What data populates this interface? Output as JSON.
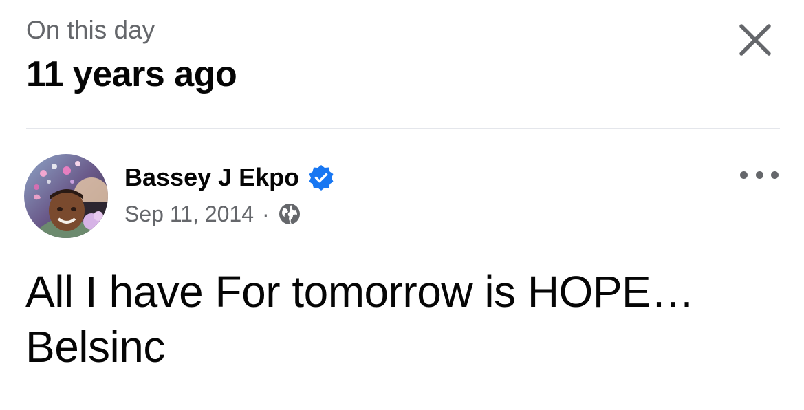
{
  "header": {
    "subtitle": "On this day",
    "title": "11 years ago"
  },
  "post": {
    "author": "Bassey J Ekpo",
    "verified": true,
    "date": "Sep 11, 2014",
    "separator": "·",
    "audience_icon": "globe-icon",
    "text_lines": [
      "All I have For tomorrow is HOPE…",
      "Belsinc"
    ]
  },
  "icons": {
    "close": "close-icon",
    "more": "more-options-icon",
    "verified": "verified-badge-icon"
  },
  "colors": {
    "primary_text": "#050505",
    "secondary_text": "#65676b",
    "verified_blue": "#1877f2",
    "divider": "#e4e6eb"
  }
}
